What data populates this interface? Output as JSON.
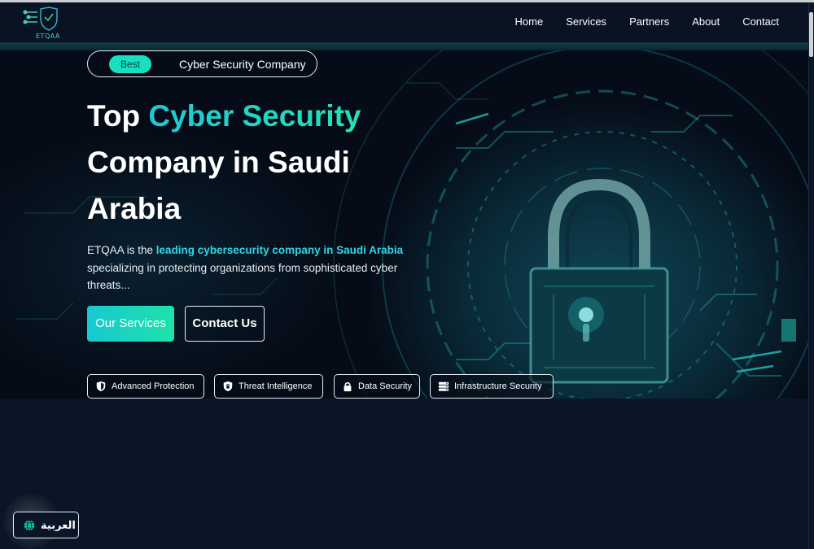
{
  "header": {
    "logo_text": "ETQAA",
    "nav": [
      {
        "label": "Home"
      },
      {
        "label": "Services"
      },
      {
        "label": "Partners"
      },
      {
        "label": "About"
      },
      {
        "label": "Contact"
      }
    ]
  },
  "hero": {
    "badge_pill": "Best",
    "badge_text": "Cyber Security Company",
    "title_pre": "Top ",
    "title_accent": "Cyber Security",
    "title_post": " Company in Saudi Arabia",
    "desc_pre": "ETQAA is the ",
    "desc_highlight": "leading cybersecurity company in Saudi Arabia",
    "desc_post": " specializing in protecting organizations from sophisticated cyber threats...",
    "primary_button": "Our Services",
    "secondary_button": "Contact Us",
    "features": [
      {
        "label": "Advanced Protection",
        "icon": "shield-icon"
      },
      {
        "label": "Threat Intelligence",
        "icon": "shield-lock-icon"
      },
      {
        "label": "Data Security",
        "icon": "lock-icon"
      },
      {
        "label": "Infrastructure Security",
        "icon": "server-icon"
      }
    ]
  },
  "language_switch": {
    "label": "العربية",
    "icon": "globe-icon"
  },
  "colors": {
    "accent_start": "#18c9d1",
    "accent_end": "#1ee2a9",
    "background": "#0b1528",
    "hero_background": "#050c17"
  }
}
